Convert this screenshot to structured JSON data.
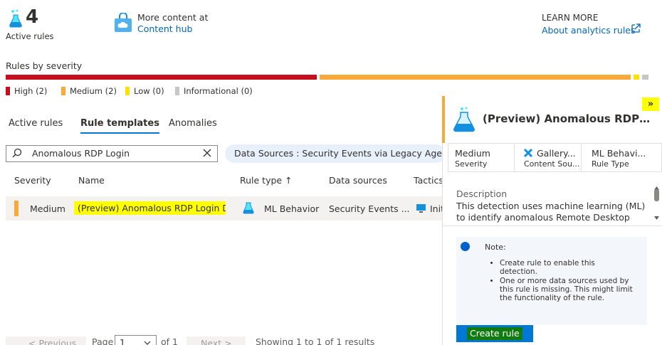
{
  "stats": {
    "active_count": "4",
    "active_label": "Active rules",
    "hub_line1": "More content at",
    "hub_line2": "Content hub",
    "learn_line1": "LEARN MORE",
    "learn_line2": "About analytics rules"
  },
  "severity": {
    "title": "Rules by severity",
    "legend": [
      {
        "label": "High (2)",
        "color": "#c50f1f"
      },
      {
        "label": "Medium (2)",
        "color": "#f7a93a"
      },
      {
        "label": "Low (0)",
        "color": "#fce100"
      },
      {
        "label": "Informational (0)",
        "color": "#c8c6c4"
      }
    ]
  },
  "tabs": [
    {
      "label": "Active rules"
    },
    {
      "label": "Rule templates",
      "active": true
    },
    {
      "label": "Anomalies"
    }
  ],
  "search": {
    "value": "Anomalous RDP Login"
  },
  "filter_pill": "Data Sources : Security Events via Legacy Agent",
  "table": {
    "headers": [
      "Severity",
      "Name",
      "Rule type ↑",
      "Data sources",
      "Tactics"
    ],
    "rows": [
      {
        "severity": "Medium",
        "name": "(Preview) Anomalous RDP Login D...",
        "rule_type": "ML Behavior",
        "data_sources": "Security Events ...",
        "tactics": "Init"
      }
    ]
  },
  "pager": {
    "prev": "< Previous",
    "page_label": "Page",
    "page_value": "1",
    "of": "of 1",
    "next": "Next >",
    "showing": "Showing 1 to 1 of 1 results"
  },
  "panel": {
    "collapse_icon": "»",
    "title": "(Preview) Anomalous RDP Login Detection",
    "meta": [
      {
        "value": "Medium",
        "label": "Severity"
      },
      {
        "value": "Gallery...",
        "label": "Content Sou..."
      },
      {
        "value": "ML Behavi...",
        "label": "Rule Type"
      }
    ],
    "desc_label": "Description",
    "desc_text": "This detection uses machine learning (ML) to identify anomalous Remote Desktop",
    "note_title": "Note:",
    "note_items": [
      "Create rule to enable this detection.",
      "One or more data sources used by this rule is missing. This might limit the functionality of the rule."
    ],
    "create_button": "Create rule"
  }
}
